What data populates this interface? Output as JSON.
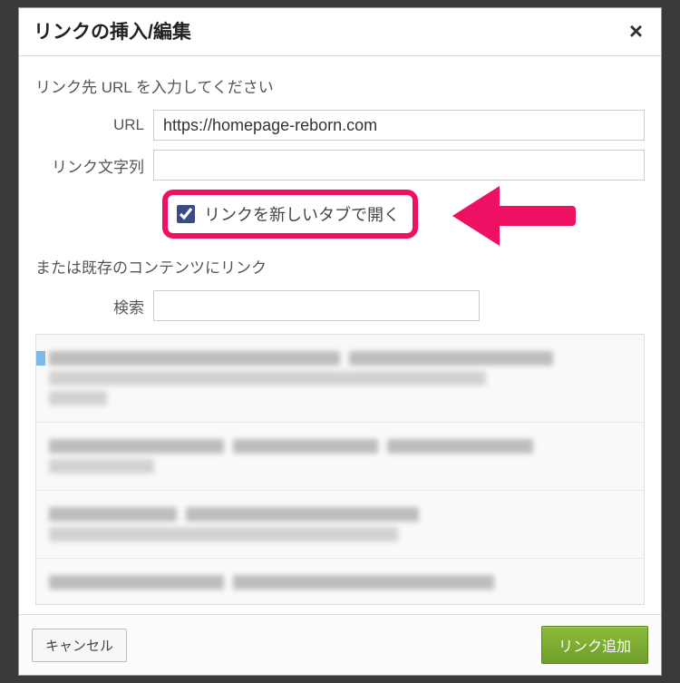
{
  "dialog": {
    "title": "リンクの挿入/編集",
    "close_icon": "×"
  },
  "prompt": "リンク先 URL を入力してください",
  "form": {
    "url_label": "URL",
    "url_value": "https://homepage-reborn.com",
    "link_text_label": "リンク文字列",
    "link_text_value": "",
    "new_tab_label": "リンクを新しいタブで開く",
    "new_tab_checked": true
  },
  "existing": {
    "heading": "または既存のコンテンツにリンク",
    "search_label": "検索",
    "search_value": ""
  },
  "footer": {
    "cancel": "キャンセル",
    "submit": "リンク追加"
  },
  "annotation": {
    "highlight_color": "#ed1063"
  }
}
